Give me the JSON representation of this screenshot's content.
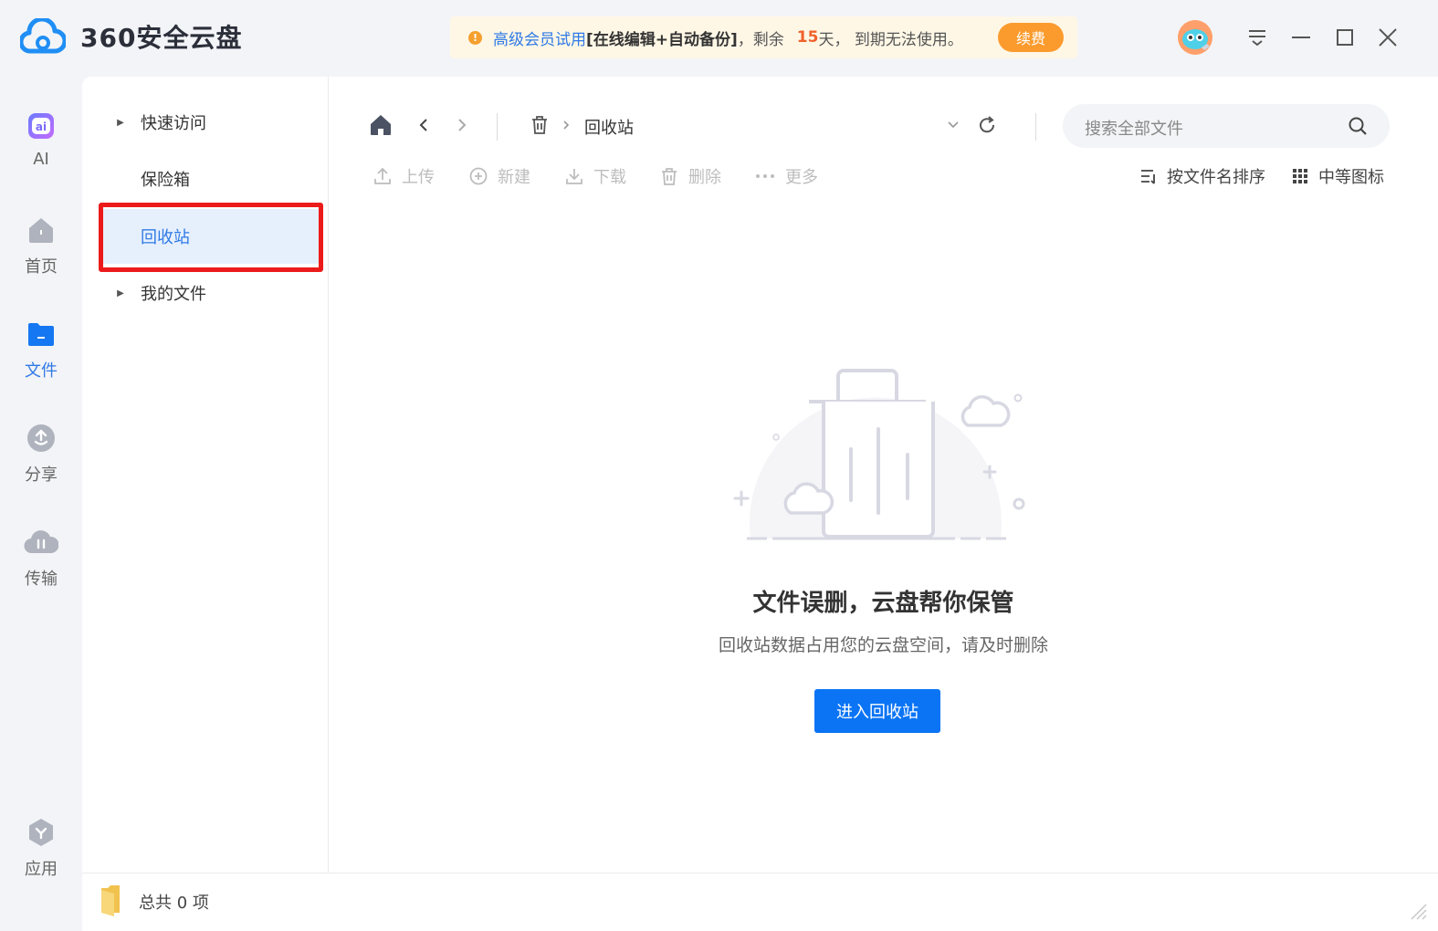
{
  "app": {
    "title": "360安全云盘"
  },
  "promo": {
    "prefix": "高级会员试用",
    "features": "[在线编辑+自动备份]",
    "remaining_label": "，剩余",
    "days": "15",
    "days_unit": "天",
    "suffix": "， 到期无法使用。",
    "renew_label": "续费"
  },
  "leftnav": {
    "items": [
      {
        "label": "AI",
        "icon": "ai-icon"
      },
      {
        "label": "首页",
        "icon": "home-icon"
      },
      {
        "label": "文件",
        "icon": "folder-icon",
        "active": true
      },
      {
        "label": "分享",
        "icon": "share-icon"
      },
      {
        "label": "传输",
        "icon": "transfer-icon"
      },
      {
        "label": "应用",
        "icon": "apps-icon"
      }
    ]
  },
  "tree": {
    "items": [
      {
        "label": "快速访问",
        "expandable": true
      },
      {
        "label": "保险箱",
        "expandable": false
      },
      {
        "label": "回收站",
        "expandable": false,
        "selected": true
      },
      {
        "label": "我的文件",
        "expandable": true
      }
    ]
  },
  "breadcrumb": {
    "current": "回收站"
  },
  "search": {
    "placeholder": "搜索全部文件"
  },
  "actions": {
    "upload": "上传",
    "new": "新建",
    "download": "下载",
    "delete": "删除",
    "more": "更多",
    "sort": "按文件名排序",
    "view": "中等图标"
  },
  "empty_state": {
    "title": "文件误删，云盘帮你保管",
    "subtitle": "回收站数据占用您的云盘空间，请及时删除",
    "button": "进入回收站"
  },
  "status": {
    "total": "总共 0 项"
  },
  "colors": {
    "accent": "#0a74f5",
    "highlight_border": "#ec1b1b",
    "renew": "#fb9b2d"
  }
}
